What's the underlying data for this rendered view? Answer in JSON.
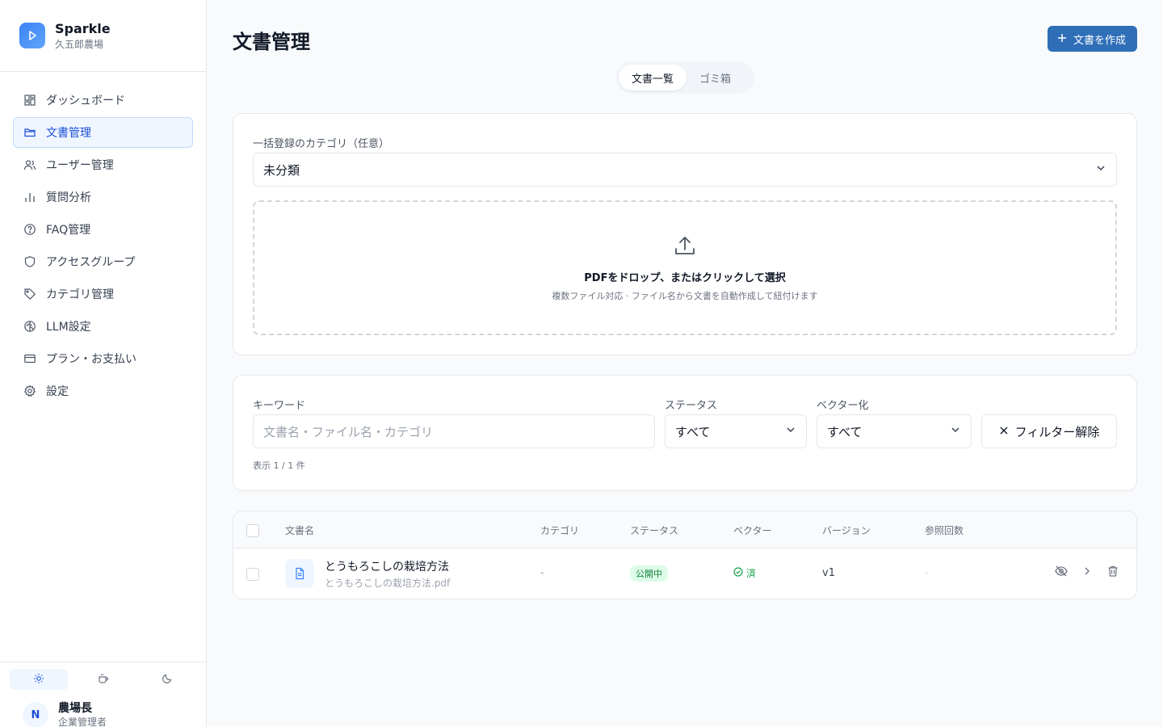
{
  "brand": {
    "name": "Sparkle",
    "org": "久五郎農場"
  },
  "sidebar": {
    "items": [
      {
        "label": "ダッシュボード",
        "icon": "dashboard-icon"
      },
      {
        "label": "文書管理",
        "icon": "folder-icon",
        "active": true
      },
      {
        "label": "ユーザー管理",
        "icon": "users-icon"
      },
      {
        "label": "質問分析",
        "icon": "bar-chart-icon"
      },
      {
        "label": "FAQ管理",
        "icon": "help-circle-icon"
      },
      {
        "label": "アクセスグループ",
        "icon": "shield-icon"
      },
      {
        "label": "カテゴリ管理",
        "icon": "tag-icon"
      },
      {
        "label": "LLM設定",
        "icon": "brain-icon"
      },
      {
        "label": "プラン・お支払い",
        "icon": "credit-card-icon"
      },
      {
        "label": "設定",
        "icon": "gear-icon"
      }
    ],
    "theme_options": [
      "sun-icon",
      "coffee-icon",
      "moon-icon"
    ],
    "user": {
      "initial": "N",
      "name": "農場長",
      "role": "企業管理者"
    }
  },
  "header": {
    "title": "文書管理",
    "create_label": "文書を作成"
  },
  "tabs": [
    {
      "label": "文書一覧",
      "active": true
    },
    {
      "label": "ゴミ箱"
    }
  ],
  "upload": {
    "category_label": "一括登録のカテゴリ（任意）",
    "category_value": "未分類",
    "drop_title": "PDFをドロップ、またはクリックして選択",
    "drop_sub": "複数ファイル対応 · ファイル名から文書を自動作成して紐付けます"
  },
  "filters": {
    "keyword_label": "キーワード",
    "keyword_placeholder": "文書名・ファイル名・カテゴリ",
    "status_label": "ステータス",
    "status_value": "すべて",
    "vector_label": "ベクター化",
    "vector_value": "すべて",
    "clear_label": "フィルター解除",
    "count_text": "表示 1 / 1 件"
  },
  "table": {
    "headers": {
      "name": "文書名",
      "category": "カテゴリ",
      "status": "ステータス",
      "vector": "ベクター",
      "version": "バージョン",
      "refs": "参照回数"
    },
    "rows": [
      {
        "name": "とうもろこしの栽培方法",
        "file": "とうもろこしの栽培方法.pdf",
        "category": "-",
        "status": "公開中",
        "vector": "済",
        "version": "v1",
        "refs": "-"
      }
    ]
  },
  "colors": {
    "primary": "#2f6fb8",
    "active_bg": "#eff6ff",
    "success": "#16a34a"
  }
}
